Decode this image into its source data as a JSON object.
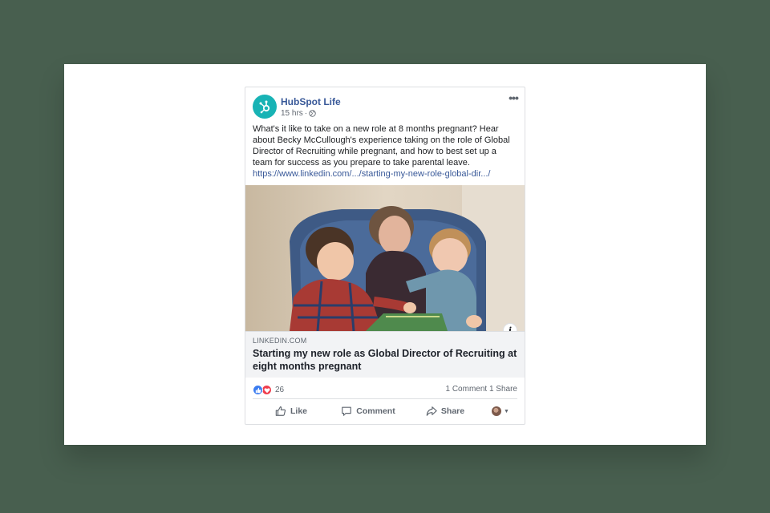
{
  "post": {
    "page_name": "HubSpot Life",
    "timestamp": "15 hrs",
    "separator": "·",
    "privacy_icon": "globe-icon",
    "body_text": "What's it like to take on a new role at 8 months pregnant? Hear about Becky McCullough's experience taking on the role of Global Director of Recruiting while pregnant, and how to best set up a team for success as you prepare to take parental leave.",
    "link_text": "https://www.linkedin.com/.../starting-my-new-role-global-dir.../"
  },
  "link_card": {
    "image_desc_icon": "photo-woman-reading-with-two-children",
    "info_label": "i",
    "domain": "LINKEDIN.COM",
    "title": "Starting my new role as Global Director of Recruiting at eight months pregnant"
  },
  "stats": {
    "reaction_count": "26",
    "comments": "1 Comment",
    "shares": "1 Share"
  },
  "actions": {
    "like": "Like",
    "comment": "Comment",
    "share": "Share"
  },
  "colors": {
    "background": "#485f4f",
    "brand_avatar": "#18b3b5",
    "link_blue": "#385898",
    "like_blue": "#3b7cf0",
    "love_red": "#f03e4e"
  }
}
